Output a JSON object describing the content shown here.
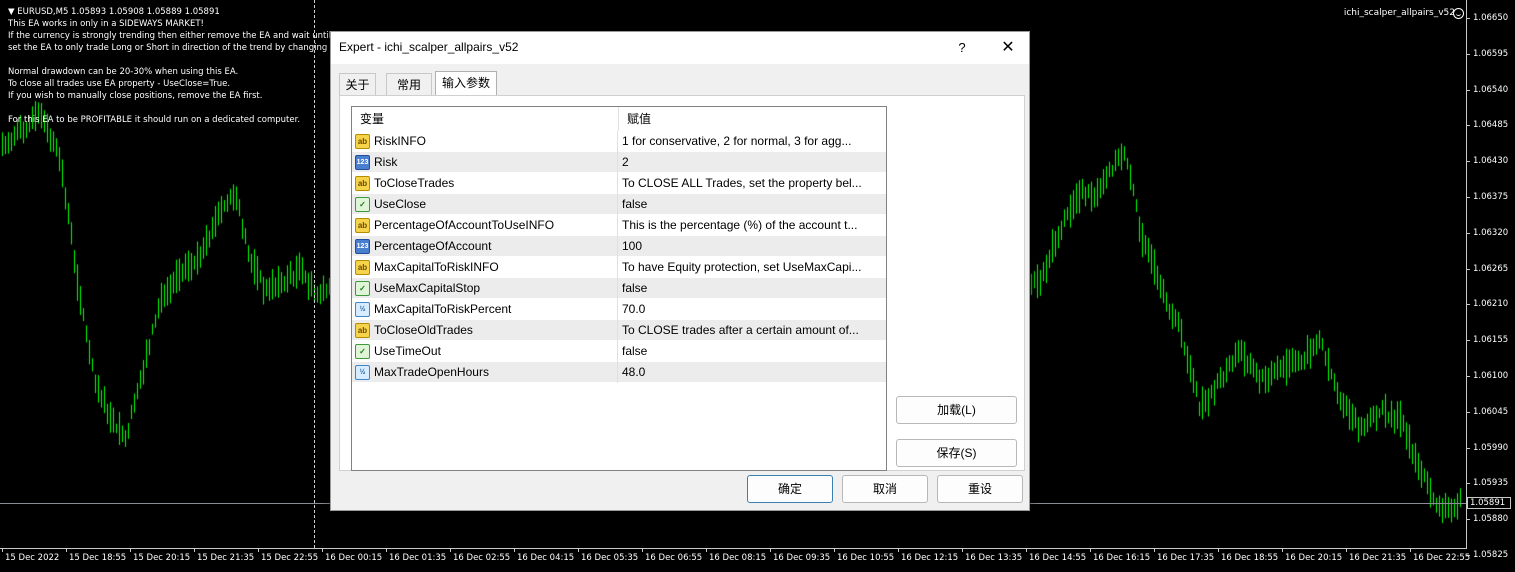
{
  "chart": {
    "symbol_line": "EURUSD,M5  1.05893 1.05908 1.05889 1.05891",
    "comments": [
      "This EA works in only in a SIDEWAYS MARKET!",
      "If the currency is strongly trending then either remove the EA and wait until t",
      "set the EA to only trade Long or Short in direction of the trend by changing th",
      "",
      "Normal drawdown can be 20-30% when using this EA.",
      "To close all trades use EA property - UseClose=True.",
      "If you wish to manually close positions, remove the EA first.",
      "",
      "For this EA to be PROFITABLE it should run on a dedicated computer."
    ],
    "ea_name": "ichi_scalper_allpairs_v52",
    "current_price": "1.05891",
    "price_labels": [
      "1.06650",
      "1.06595",
      "1.06540",
      "1.06485",
      "1.06430",
      "1.06375",
      "1.06320",
      "1.06265",
      "1.06210",
      "1.06155",
      "1.06100",
      "1.06045",
      "1.05990",
      "1.05935",
      "1.05880",
      "1.05825"
    ],
    "time_labels": [
      "15 Dec 2022",
      "15 Dec 18:55",
      "15 Dec 20:15",
      "15 Dec 21:35",
      "15 Dec 22:55",
      "16 Dec 00:15",
      "16 Dec 01:35",
      "16 Dec 02:55",
      "16 Dec 04:15",
      "16 Dec 05:35",
      "16 Dec 06:55",
      "16 Dec 08:15",
      "16 Dec 09:35",
      "16 Dec 10:55",
      "16 Dec 12:15",
      "16 Dec 13:35",
      "16 Dec 14:55",
      "16 Dec 16:15",
      "16 Dec 17:35",
      "16 Dec 18:55",
      "16 Dec 20:15",
      "16 Dec 21:35",
      "16 Dec 22:55"
    ],
    "candle_color": "#00ff00",
    "background_color": "#000000"
  },
  "dialog": {
    "title": "Expert - ichi_scalper_allpairs_v52",
    "help_label": "?",
    "close_label": "✕",
    "tabs": [
      {
        "label": "关于",
        "active": false
      },
      {
        "label": "常用",
        "active": false
      },
      {
        "label": "输入参数",
        "active": true
      }
    ],
    "table": {
      "col_name": "变量",
      "col_value": "赋值",
      "rows": [
        {
          "type": "string",
          "icon_text": "ab",
          "name": "RiskINFO",
          "value": "1 for conservative, 2 for normal, 3 for agg..."
        },
        {
          "type": "int",
          "icon_text": "123",
          "name": "Risk",
          "value": "2"
        },
        {
          "type": "string",
          "icon_text": "ab",
          "name": "ToCloseTrades",
          "value": "To CLOSE ALL Trades, set the property bel..."
        },
        {
          "type": "bool",
          "icon_text": "✓",
          "name": "UseClose",
          "value": "false"
        },
        {
          "type": "string",
          "icon_text": "ab",
          "name": "PercentageOfAccountToUseINFO",
          "value": "This is the percentage (%) of the account t..."
        },
        {
          "type": "int",
          "icon_text": "123",
          "name": "PercentageOfAccount",
          "value": "100"
        },
        {
          "type": "string",
          "icon_text": "ab",
          "name": "MaxCapitalToRiskINFO",
          "value": "To have Equity protection, set UseMaxCapi..."
        },
        {
          "type": "bool",
          "icon_text": "✓",
          "name": "UseMaxCapitalStop",
          "value": "false"
        },
        {
          "type": "double",
          "icon_text": "½",
          "name": "MaxCapitalToRiskPercent",
          "value": "70.0"
        },
        {
          "type": "string",
          "icon_text": "ab",
          "name": "ToCloseOldTrades",
          "value": "To CLOSE trades after a certain amount of..."
        },
        {
          "type": "bool",
          "icon_text": "✓",
          "name": "UseTimeOut",
          "value": "false"
        },
        {
          "type": "double",
          "icon_text": "½",
          "name": "MaxTradeOpenHours",
          "value": "48.0"
        }
      ]
    },
    "buttons": {
      "load": "加载(L)",
      "save": "保存(S)",
      "ok": "确定",
      "cancel": "取消",
      "reset": "重设"
    }
  }
}
